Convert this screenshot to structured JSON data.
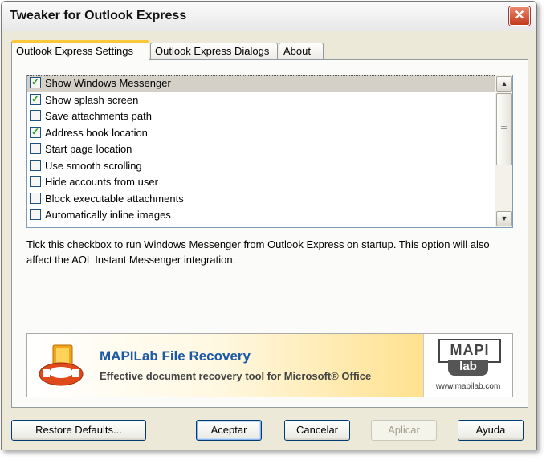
{
  "window": {
    "title": "Tweaker for Outlook Express",
    "close_label": "✕"
  },
  "tabs": [
    {
      "label": "Outlook Express Settings"
    },
    {
      "label": "Outlook Express Dialogs"
    },
    {
      "label": "About"
    }
  ],
  "options": [
    {
      "label": "Show Windows Messenger",
      "checked": true
    },
    {
      "label": "Show splash screen",
      "checked": true
    },
    {
      "label": "Save attachments path",
      "checked": false
    },
    {
      "label": "Address book location",
      "checked": true
    },
    {
      "label": "Start page location",
      "checked": false
    },
    {
      "label": "Use smooth scrolling",
      "checked": false
    },
    {
      "label": "Hide accounts from user",
      "checked": false
    },
    {
      "label": "Block executable attachments",
      "checked": false
    },
    {
      "label": "Automatically inline images",
      "checked": false
    }
  ],
  "description": "Tick this checkbox to run Windows Messenger from Outlook Express on startup. This option will also affect the AOL Instant Messenger integration.",
  "banner": {
    "title": "MAPILab File Recovery",
    "subtitle": "Effective document recovery tool for Microsoft® Office",
    "logo_top": "MAPI",
    "logo_bottom": "lab",
    "url": "www.mapilab.com"
  },
  "buttons": {
    "restore": "Restore Defaults...",
    "accept": "Aceptar",
    "cancel": "Cancelar",
    "apply": "Aplicar",
    "help": "Ayuda"
  },
  "colors": {
    "accent_tab": "#ffc83c",
    "check": "#21a121",
    "banner_title": "#1c5aa6"
  }
}
